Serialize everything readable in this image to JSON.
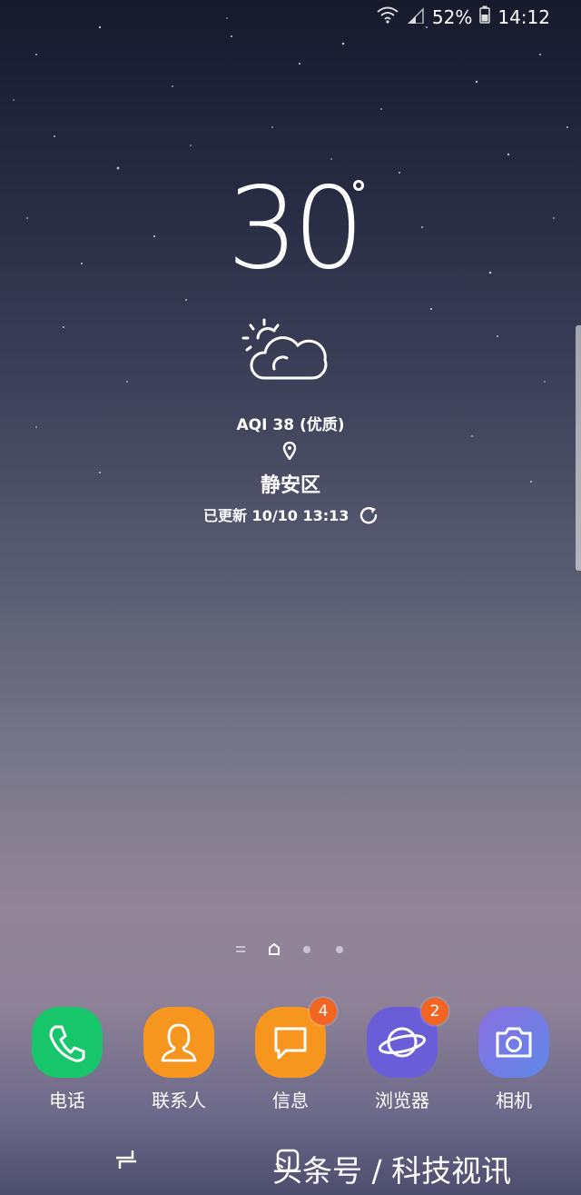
{
  "status_bar": {
    "battery_percent": "52%",
    "time": "14:12",
    "icons": [
      "wifi-icon",
      "signal-icon",
      "battery-icon"
    ]
  },
  "weather": {
    "temperature": "30",
    "condition_icon": "partly-cloudy-icon",
    "aqi": "AQI 38 (优质)",
    "location": "静安区",
    "updated": "已更新 10/10 13:13"
  },
  "dock": {
    "apps": [
      {
        "label": "电话",
        "icon": "phone-icon",
        "color": "#17c56b",
        "badge": ""
      },
      {
        "label": "联系人",
        "icon": "contacts-icon",
        "color": "#f7961e",
        "badge": ""
      },
      {
        "label": "信息",
        "icon": "messages-icon",
        "color": "#f7961e",
        "badge": "4"
      },
      {
        "label": "浏览器",
        "icon": "browser-icon",
        "color": "#6a5ed8",
        "badge": "2"
      },
      {
        "label": "相机",
        "icon": "camera-icon",
        "color": "#6f6be0",
        "badge": ""
      }
    ]
  },
  "watermark": "头条号 / 科技视讯"
}
